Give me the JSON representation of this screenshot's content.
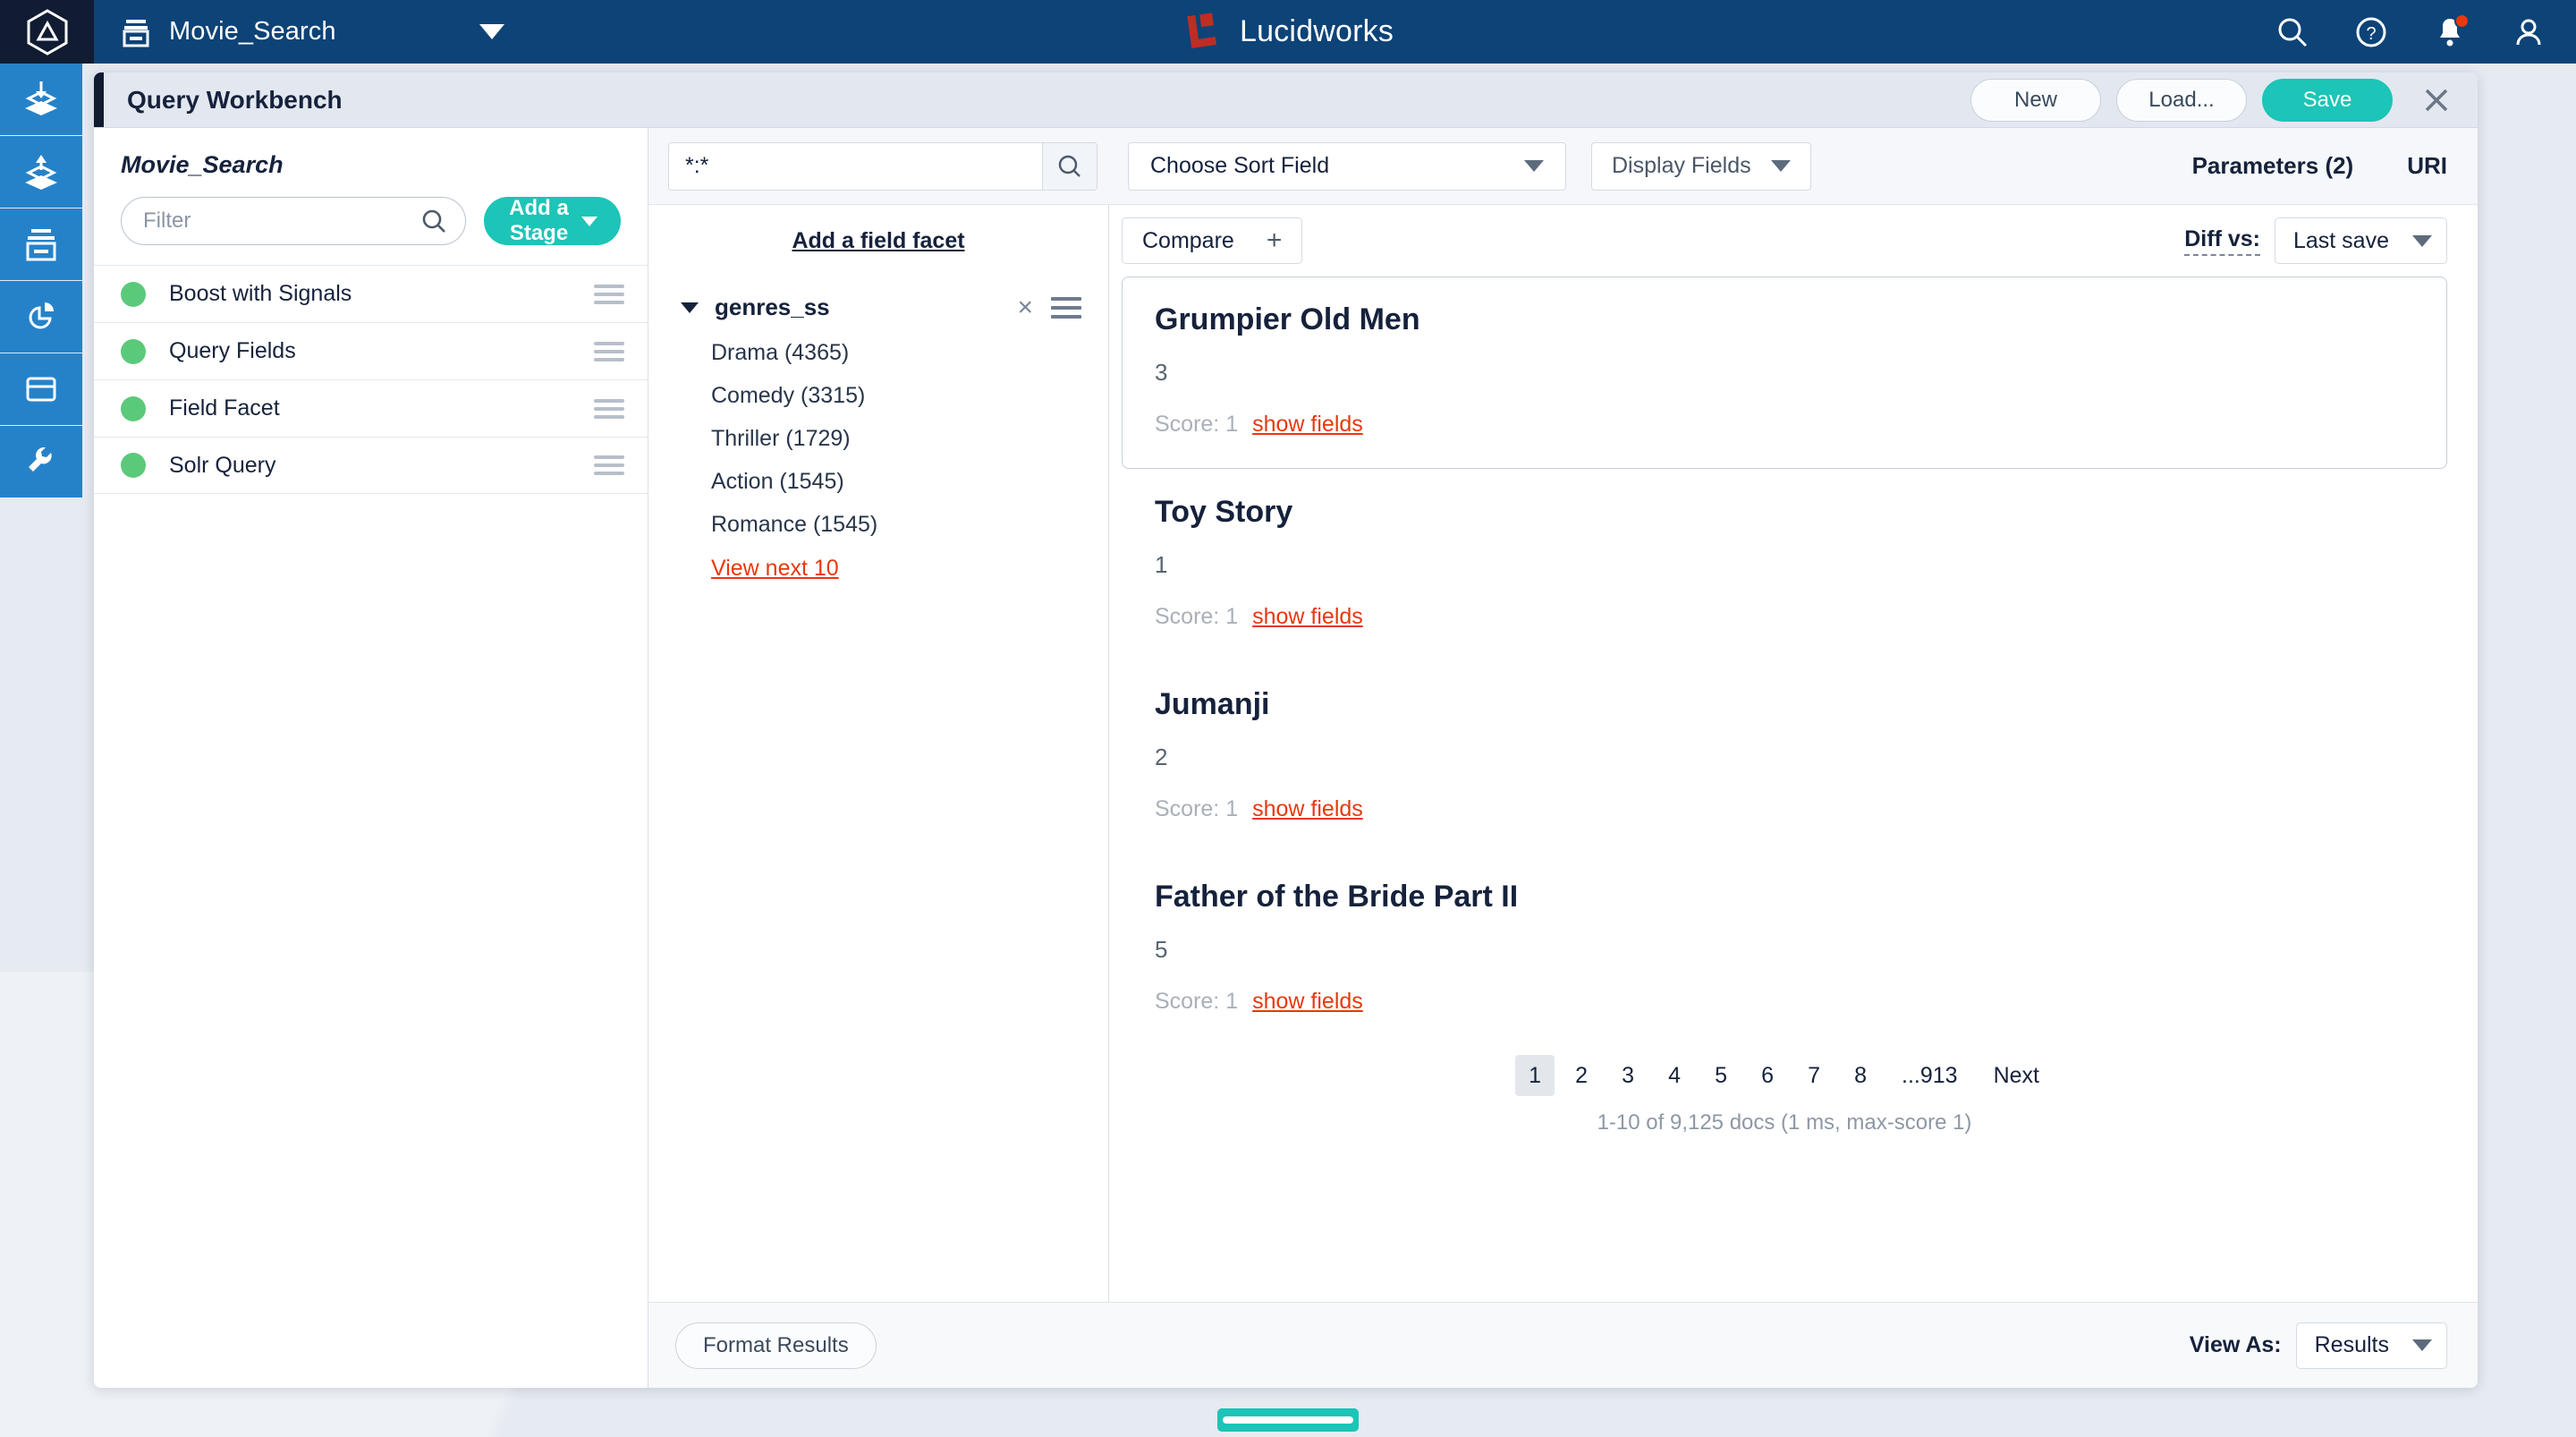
{
  "topnav": {
    "logo_icon": "hexagon-logo-icon",
    "app_icon": "collection-icon",
    "app_name": "Movie_Search",
    "app_caret_icon": "chevron-down-icon",
    "brand_mark_icon": "lucidworks-logo-icon",
    "brand_text": "Lucidworks",
    "brand_accent": "#bd2d24",
    "background": "#0d4377",
    "icons": [
      {
        "name": "search-icon"
      },
      {
        "name": "help-icon"
      },
      {
        "name": "notifications-bell-icon",
        "badge": true,
        "badge_color": "#e8380d"
      },
      {
        "name": "user-account-icon"
      }
    ]
  },
  "rail": {
    "background": "#2682c8",
    "items": [
      {
        "name": "indexing-icon"
      },
      {
        "name": "querying-icon"
      },
      {
        "name": "collections-icon"
      },
      {
        "name": "analytics-icon"
      },
      {
        "name": "apps-icon"
      },
      {
        "name": "tools-icon"
      }
    ]
  },
  "modal": {
    "title": "Query Workbench",
    "accent_color": "#111c33",
    "actions": {
      "new_label": "New",
      "load_label": "Load...",
      "save_label": "Save",
      "save_color": "#1cc5b7",
      "close_icon": "close-icon"
    }
  },
  "stages": {
    "pipeline_name": "Movie_Search",
    "filter_placeholder": "Filter",
    "filter_value": "",
    "filter_icon": "search-icon",
    "add_stage_label": "Add a Stage",
    "add_stage_color": "#1cc5b7",
    "status_color": "#5bc97a",
    "items": [
      {
        "label": "Boost with Signals",
        "status": "enabled"
      },
      {
        "label": "Query Fields",
        "status": "enabled"
      },
      {
        "label": "Field Facet",
        "status": "enabled"
      },
      {
        "label": "Solr Query",
        "status": "enabled"
      }
    ]
  },
  "query_bar": {
    "query_value": "*:*",
    "query_placeholder": "",
    "search_icon": "search-icon",
    "sort_field_label": "Choose Sort Field",
    "display_fields_label": "Display Fields",
    "parameters_label": "Parameters (2)",
    "uri_label": "URI"
  },
  "facets": {
    "add_facet_label": "Add a field facet",
    "field_name": "genres_ss",
    "collapse_icon": "chevron-down-icon",
    "remove_icon": "close-icon",
    "menu_icon": "hamburger-menu-icon",
    "values": [
      "Drama (4365)",
      "Comedy (3315)",
      "Thriller (1729)",
      "Action (1545)",
      "Romance (1545)"
    ],
    "more_label": "View next 10",
    "link_color": "#e8380d"
  },
  "results_toolbar": {
    "compare_label": "Compare",
    "compare_add_icon": "plus-icon",
    "diff_label": "Diff vs:",
    "diff_value": "Last save",
    "diff_caret_icon": "chevron-down-icon"
  },
  "results": {
    "score_prefix": "Score: 1",
    "show_fields_label": "show fields",
    "items": [
      {
        "title": "Grumpier Old Men",
        "id": "3",
        "score": "Score: 1",
        "highlighted": true
      },
      {
        "title": "Toy Story",
        "id": "1",
        "score": "Score: 1",
        "highlighted": false
      },
      {
        "title": "Jumanji",
        "id": "2",
        "score": "Score: 1",
        "highlighted": false
      },
      {
        "title": "Father of the Bride Part II",
        "id": "5",
        "score": "Score: 1",
        "highlighted": false
      }
    ]
  },
  "pagination": {
    "pages": [
      "1",
      "2",
      "3",
      "4",
      "5",
      "6",
      "7",
      "8",
      "...913"
    ],
    "active_page": "1",
    "next_label": "Next",
    "summary": "1-10 of 9,125 docs (1 ms, max-score 1)"
  },
  "footer": {
    "format_results_label": "Format Results",
    "view_as_label": "View As:",
    "view_as_value": "Results",
    "view_as_caret_icon": "chevron-down-icon"
  },
  "bottom_handle": {
    "name": "drawer-handle",
    "color": "#1cc5b7"
  }
}
